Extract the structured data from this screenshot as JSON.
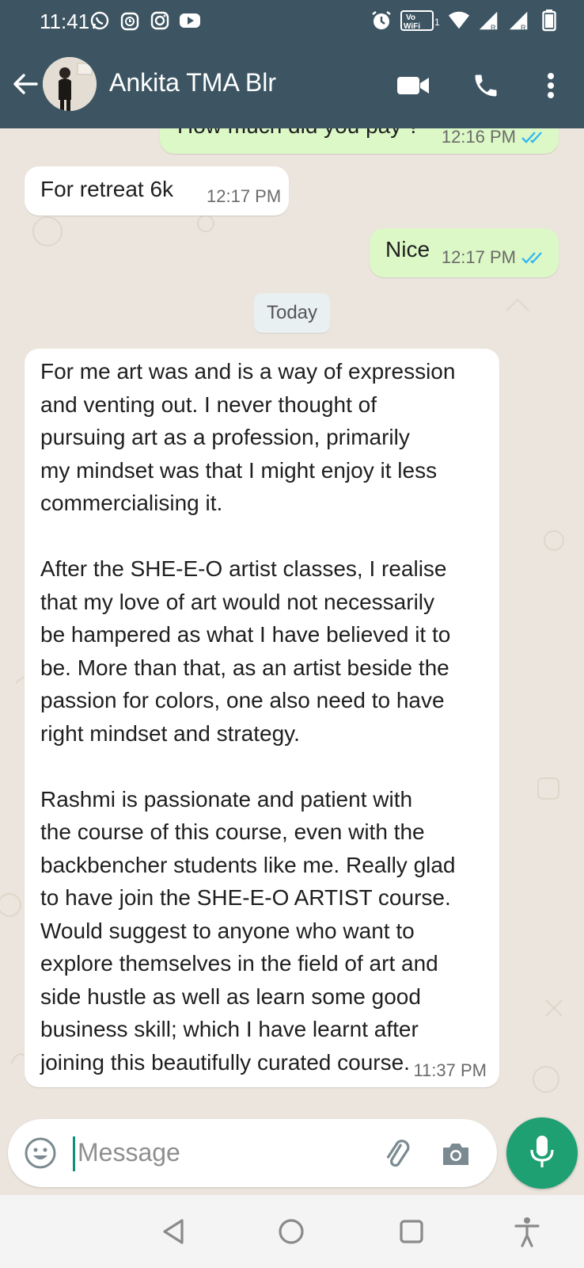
{
  "status_bar": {
    "time": "11:41",
    "volte_label_top": "Vo",
    "volte_label_bottom": "WiFi",
    "volte_sub": "1"
  },
  "header": {
    "contact_name": "Ankita TMA Blr"
  },
  "messages": [
    {
      "direction": "out",
      "text": "How much did you pay ?",
      "time": "12:16 PM",
      "status": "read"
    },
    {
      "direction": "in",
      "text": "For retreat 6k",
      "time": "12:17 PM"
    },
    {
      "direction": "out",
      "text": "Nice",
      "time": "12:17 PM",
      "status": "read"
    },
    {
      "direction": "in",
      "time": "11:37 PM",
      "text": "For me art was and is a way of expression\nand venting out. I never thought of\npursuing art as a profession, primarily\nmy mindset was that I might enjoy it less\ncommercialising it.\n\nAfter the SHE-E-O artist classes, I realise\nthat my love of art would not necessarily\nbe hampered as what I have believed it to\nbe. More than that, as an artist beside the\npassion for colors, one also need to have\nright mindset and strategy.\n\nRashmi is passionate and patient with\nthe course of this course, even with the\nbackbencher students like me. Really glad\nto have join the SHE-E-O ARTIST course.\nWould suggest to anyone who want to\nexplore themselves in the field of art and\nside hustle as well as learn some good\nbusiness skill; which I have learnt after\njoining this beautifully curated course."
    }
  ],
  "day_separator": "Today",
  "composer": {
    "placeholder": "Message"
  },
  "colors": {
    "header": "#3d5563",
    "chat_bg": "#ece5dd",
    "outgoing": "#dcf8c6",
    "incoming": "#ffffff",
    "accent": "#1ea073",
    "read_tick": "#34b7f1"
  }
}
